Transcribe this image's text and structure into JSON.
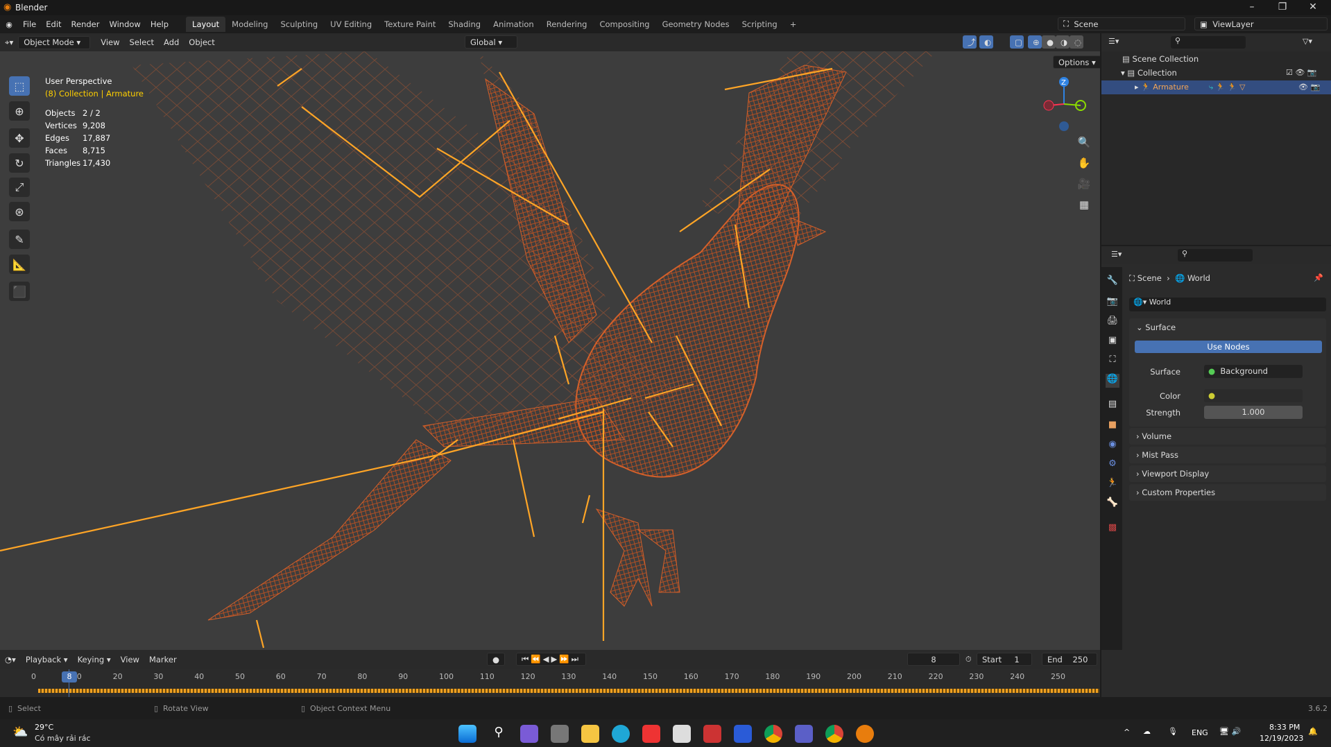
{
  "app": {
    "title": "Blender",
    "version": "3.6.2"
  },
  "menu": [
    "File",
    "Edit",
    "Render",
    "Window",
    "Help"
  ],
  "workspaces": [
    "Layout",
    "Modeling",
    "Sculpting",
    "UV Editing",
    "Texture Paint",
    "Shading",
    "Animation",
    "Rendering",
    "Compositing",
    "Geometry Nodes",
    "Scripting"
  ],
  "scene": {
    "name": "Scene",
    "view_layer": "ViewLayer"
  },
  "viewport_header": {
    "mode": "Object Mode",
    "menus": [
      "View",
      "Select",
      "Add",
      "Object"
    ],
    "orientation": "Global",
    "options": "Options"
  },
  "overlay": {
    "view": "User Perspective",
    "collection": "(8) Collection | Armature",
    "stats": [
      {
        "k": "Objects",
        "v": "2 / 2"
      },
      {
        "k": "Vertices",
        "v": "9,208"
      },
      {
        "k": "Edges",
        "v": "17,887"
      },
      {
        "k": "Faces",
        "v": "8,715"
      },
      {
        "k": "Triangles",
        "v": "17,430"
      }
    ]
  },
  "gizmo": {
    "z": "Z"
  },
  "outliner": {
    "root": "Scene Collection",
    "collection": "Collection",
    "item": "Armature"
  },
  "properties": {
    "breadcrumb": [
      "Scene",
      "World"
    ],
    "world": "World",
    "surface_panel": "Surface",
    "use_nodes": "Use Nodes",
    "surface_label": "Surface",
    "surface_value": "Background",
    "color_label": "Color",
    "strength_label": "Strength",
    "strength_value": "1.000",
    "panels": [
      "Volume",
      "Mist Pass",
      "Viewport Display",
      "Custom Properties"
    ]
  },
  "timeline": {
    "menus": [
      "Playback",
      "Keying",
      "View",
      "Marker"
    ],
    "current_frame": "8",
    "start_label": "Start",
    "start": "1",
    "end_label": "End",
    "end": "250",
    "ticks": [
      "0",
      "10",
      "20",
      "30",
      "40",
      "50",
      "60",
      "70",
      "80",
      "90",
      "100",
      "110",
      "120",
      "130",
      "140",
      "150",
      "160",
      "170",
      "180",
      "190",
      "200",
      "210",
      "220",
      "230",
      "240",
      "250"
    ]
  },
  "statusbar": {
    "select": "Select",
    "rotate": "Rotate View",
    "context": "Object Context Menu"
  },
  "taskbar": {
    "temp": "29°C",
    "weather": "Có mây rải rác",
    "lang": "ENG",
    "time": "8:33 PM",
    "date": "12/19/2023"
  },
  "colors": {
    "accent": "#4772b3",
    "wire": "#e8702a",
    "bone": "#ffa526"
  }
}
